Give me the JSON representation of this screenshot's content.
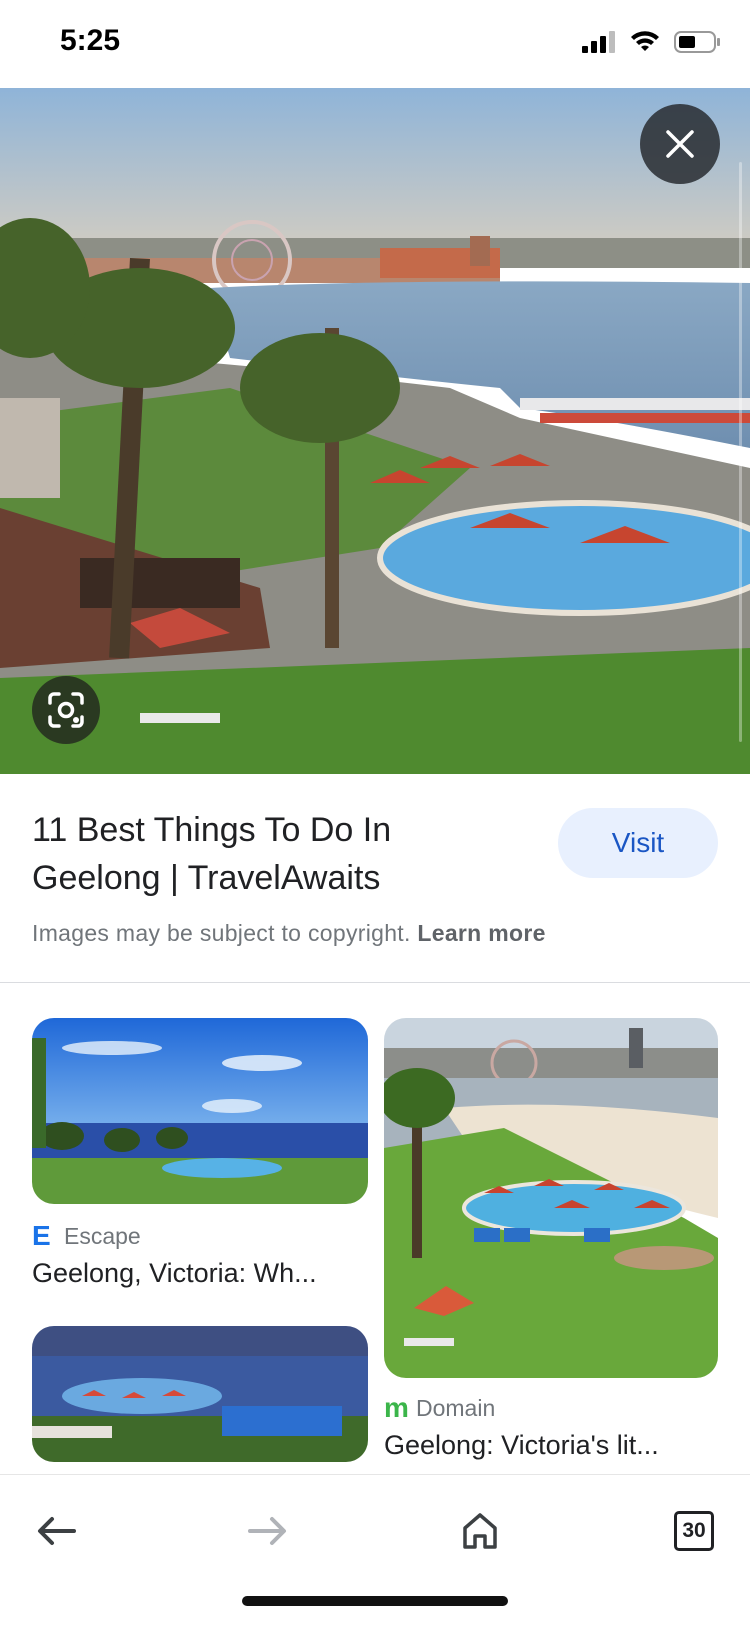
{
  "status": {
    "time": "5:25"
  },
  "preview": {
    "title": "11 Best Things To Do In Geelong | TravelAwaits",
    "visit_label": "Visit",
    "copyright_text": "Images may be subject to copyright.",
    "learn_more": "Learn more"
  },
  "related": [
    {
      "source_name": "Escape",
      "source_logo": "E",
      "source_color": "#1a73e8",
      "title": "Geelong, Victoria: Wh..."
    },
    {
      "source_name": "Domain",
      "source_logo": "m",
      "source_color": "#3bb54a",
      "title": "Geelong: Victoria's lit..."
    }
  ],
  "toolbar": {
    "tab_count": "30"
  },
  "icons": [
    "close-icon",
    "lens-icon",
    "back-arrow-icon",
    "forward-arrow-icon",
    "home-icon",
    "tabs-icon"
  ],
  "colors": {
    "accent": "#1a56c4",
    "visit_bg": "#e8f0fe"
  }
}
